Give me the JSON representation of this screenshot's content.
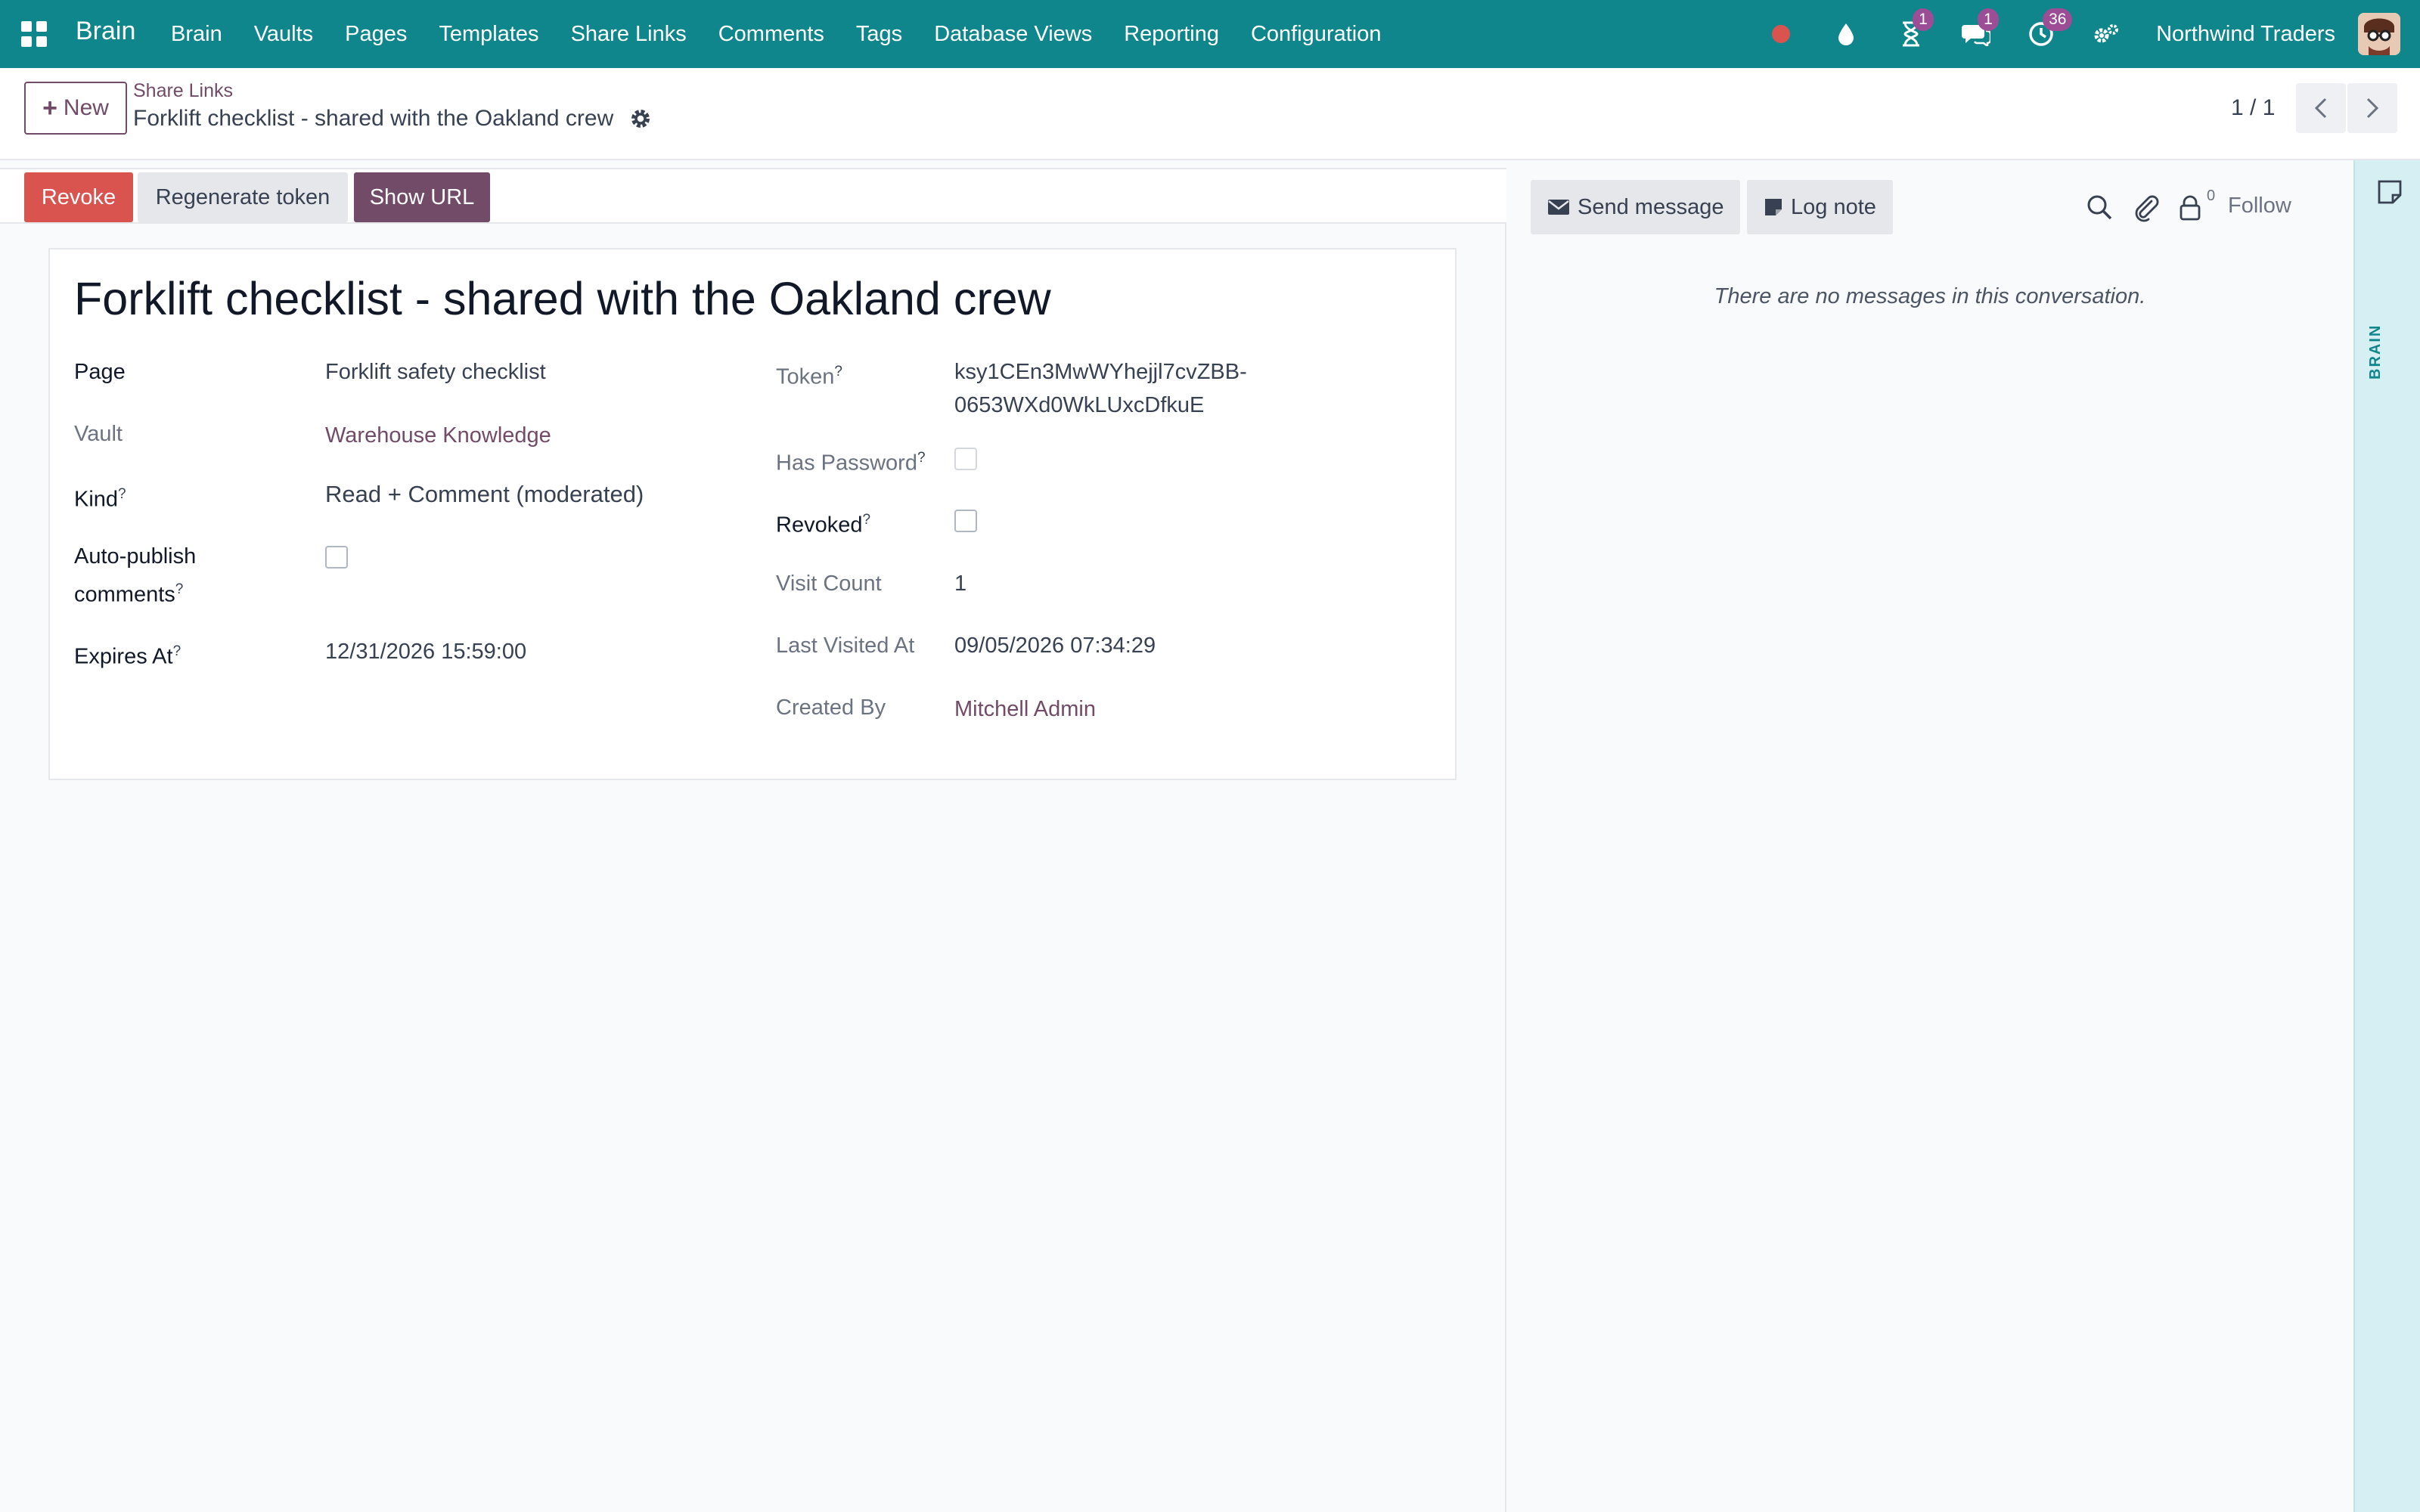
{
  "navbar": {
    "brand": "Brain",
    "menu": [
      "Brain",
      "Vaults",
      "Pages",
      "Templates",
      "Share Links",
      "Comments",
      "Tags",
      "Database Views",
      "Reporting",
      "Configuration"
    ],
    "badges": {
      "activities": "1",
      "messages": "1",
      "clock": "36"
    },
    "company": "Northwind Traders",
    "icons": [
      "apps-grid-icon",
      "recording-dot-icon",
      "drop-icon",
      "hourglass-icon",
      "chat-icon",
      "clock-icon",
      "settings-cogs-icon"
    ]
  },
  "control_panel": {
    "new_label": "New",
    "breadcrumb_parent": "Share Links",
    "breadcrumb_current": "Forklift checklist - shared with the Oakland crew",
    "pager": "1 / 1"
  },
  "statusbar": {
    "revoke": "Revoke",
    "regenerate": "Regenerate token",
    "show_url": "Show URL"
  },
  "record": {
    "title": "Forklift checklist - shared with the Oakland crew",
    "labels": {
      "page": "Page",
      "vault": "Vault",
      "kind": "Kind",
      "auto_publish_1": "Auto-publish",
      "auto_publish_2": "comments",
      "expires_at": "Expires At",
      "token": "Token",
      "has_password": "Has Password",
      "revoked": "Revoked",
      "visit_count": "Visit Count",
      "last_visited_at": "Last Visited At",
      "created_by": "Created By",
      "help_mark": "?"
    },
    "values": {
      "page": "Forklift safety checklist",
      "vault": "Warehouse Knowledge",
      "kind": "Read + Comment (moderated)",
      "auto_publish": false,
      "expires_at": "12/31/2026 15:59:00",
      "token_line1": "ksy1CEn3MwWYhejjl7cvZBB-",
      "token_line2": "0653WXd0WkLUxcDfkuE",
      "has_password": false,
      "revoked": false,
      "visit_count": "1",
      "last_visited_at": "09/05/2026 07:34:29",
      "created_by": "Mitchell Admin"
    }
  },
  "chatter": {
    "send_message": "Send message",
    "log_note": "Log note",
    "follower_count": "0",
    "follow": "Follow",
    "empty": "There are no messages in this conversation."
  },
  "side_tab": {
    "label": "BRAIN"
  },
  "colors": {
    "navbar": "#0f868c",
    "primary": "#714b67",
    "danger": "#d9534f",
    "badge": "#9b4d96"
  }
}
